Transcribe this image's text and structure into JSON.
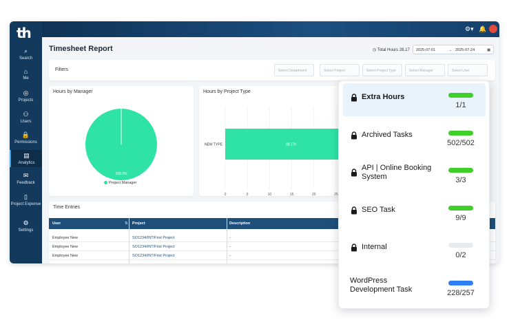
{
  "app": {
    "logo": "th"
  },
  "sidebar": {
    "items": [
      {
        "label": "Search",
        "icon": "search-icon",
        "glyph": "⌕"
      },
      {
        "label": "Me",
        "icon": "home-icon",
        "glyph": "⌂"
      },
      {
        "label": "Projects",
        "icon": "projects-icon",
        "glyph": "◎"
      },
      {
        "label": "Users",
        "icon": "users-icon",
        "glyph": "⚇"
      },
      {
        "label": "Permissions",
        "icon": "lock-icon",
        "glyph": "🔒"
      },
      {
        "label": "Analytics",
        "icon": "analytics-icon",
        "glyph": "▤"
      },
      {
        "label": "Feedback",
        "icon": "chat-icon",
        "glyph": "✉"
      },
      {
        "label": "Project Expense",
        "icon": "expense-icon",
        "glyph": "▯"
      },
      {
        "label": "Settings",
        "icon": "gear-icon",
        "glyph": "⚙"
      }
    ]
  },
  "header": {
    "title": "Timesheet Report",
    "total_hours_label": "Total Hours",
    "total_hours_value": "28.17",
    "date_from": "2025-07-01",
    "date_to": "2025-07-24",
    "date_sep": "→"
  },
  "filters": {
    "label": "Filters",
    "selects": [
      "Select Department",
      "Select Project",
      "Select Project Type",
      "Select Manager",
      "Select User"
    ]
  },
  "charts": {
    "manager_title": "Hours by Manager",
    "project_type_title": "Hours by Project Type",
    "accent": "#2ee3a5"
  },
  "chart_data": [
    {
      "type": "pie",
      "title": "Hours by Manager",
      "categories": [
        "Project Manager"
      ],
      "values": [
        100.0
      ],
      "slice_label": "100.0%",
      "legend": [
        "Project Manager"
      ]
    },
    {
      "type": "bar",
      "title": "Hours by Project Type",
      "orientation": "horizontal",
      "categories": [
        "NEW TYPE"
      ],
      "values": [
        28.17
      ],
      "data_label": "28.17h",
      "xlim": [
        0,
        25
      ],
      "xticks": [
        "0",
        "5",
        "10",
        "15",
        "20",
        "25"
      ]
    }
  ],
  "entries": {
    "title": "Time Entries",
    "columns": [
      "User",
      "Project",
      "Description"
    ],
    "rows": [
      {
        "user": "Employee New",
        "project": "SO1234/INT/First Project",
        "description": "-"
      },
      {
        "user": "Employee New",
        "project": "SO1234/INT/First Project",
        "description": "-"
      },
      {
        "user": "Employee New",
        "project": "SO1234/INT/First Project",
        "description": "-"
      }
    ]
  },
  "popup": {
    "items": [
      {
        "name": "Extra Hours",
        "count": "1/1",
        "progress": 1.0,
        "color": "#3fcf29",
        "locked": true,
        "highlight": true
      },
      {
        "name": "Archived Tasks",
        "count": "502/502",
        "progress": 1.0,
        "color": "#3fcf29",
        "locked": true
      },
      {
        "name": "API | Online Booking System",
        "count": "3/3",
        "progress": 1.0,
        "color": "#3fcf29",
        "locked": true
      },
      {
        "name": "SEO Task",
        "count": "9/9",
        "progress": 1.0,
        "color": "#3fcf29",
        "locked": true
      },
      {
        "name": "Internal",
        "count": "0/2",
        "progress": 0.0,
        "color": "#e9ecef",
        "locked": true
      },
      {
        "name": "WordPress Development Task",
        "count": "228/257",
        "progress": 0.89,
        "color": "#2f7ff5",
        "locked": false
      }
    ]
  }
}
